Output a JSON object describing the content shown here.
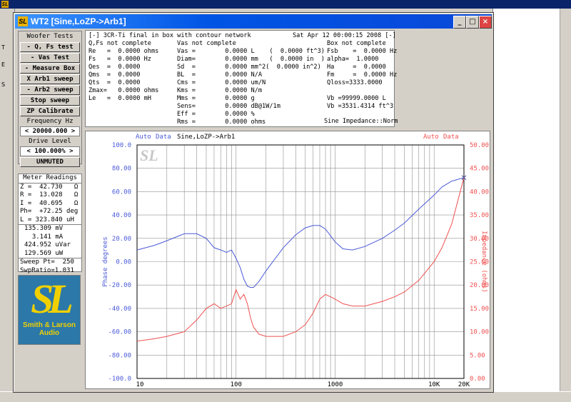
{
  "window": {
    "title": "WT2 [Sine,LoZP->Arb1]"
  },
  "left_panel": {
    "header": "Woofer Tests",
    "buttons": [
      "- Q, Fs test",
      "- Vas Test",
      "- Measure Box",
      "X Arb1 sweep",
      "- Arb2 sweep",
      "Stop sweep",
      "ZP Calibrate"
    ],
    "freq_label": "Frequency Hz",
    "freq_value": "< 20000.000 >",
    "drive_label": "Drive Level",
    "drive_value": "< 100.000% >",
    "mute": "UNMUTED"
  },
  "meter": {
    "header": "Meter Readings",
    "rows": [
      "Z =  42.730   Ω",
      "R =  13.028   Ω",
      "I =  40.695   Ω",
      "Ph=  +72.25 deg",
      "L = 323.840 uH"
    ],
    "rows2": [
      "135.309 mV",
      "  3.141 mA",
      "424.952 uVar",
      "129.569 uW"
    ],
    "rows3": [
      "Sweep Pt=  250",
      "SwpRatio=1.031"
    ]
  },
  "logo": {
    "name_line1": "Smith & Larson",
    "name_line2": "Audio"
  },
  "info": {
    "header_left": "[-] 3CR-Ti final in box with contour network",
    "header_right": "Sat Apr 12 00:00:15 2008 [-]",
    "col1_title": "Q,Fs not complete",
    "col2_title": "Vas not complete",
    "col3_title": "Box not complete",
    "col1": [
      "Re   =  0.0000 ohms",
      "Fs   =  0.0000 Hz",
      "Qes  =  0.0000",
      "Qms  =  0.0000",
      "Qts  =  0.0000",
      "Zmax=   0.0000 ohms",
      "Le   =  0.0000 mH"
    ],
    "col2": [
      "Vas =        0.0000 L    (  0.0000 ft^3)",
      "Diam=        0.0000 mm   (  0.0000 in  )",
      "Sd  =        0.0000 mm^2(  0.0000 in^2)",
      "BL  =        0.0000 N/A",
      "Cms =        0.0000 um/N",
      "Kms =        0.0000 N/m",
      "Mms =        0.0000 g",
      "Sens=        0.0000 dB@1W/1m",
      "Eff =        0.0000 %",
      "Rms =        0.0000 ohms"
    ],
    "col3": [
      "Fsb    =  0.0000 Hz",
      "alpha=  1.0000",
      "Ha     =  0.0000",
      "Fm     =  0.0000 Hz",
      "Qloss=3333.0000",
      "",
      "Vb =99999.0000 L",
      "Vb =3531.4314 ft^3"
    ],
    "footer_right": "Sine Impedance::Norm"
  },
  "graph": {
    "left_tags": [
      "Auto",
      "Data"
    ],
    "right_tags": [
      "Auto",
      "Data"
    ],
    "title": "Sine,LoZP->Arb1"
  },
  "colors": {
    "phase": "#4a5ad8",
    "impedance": "#f05050",
    "grid": "#909090"
  },
  "chart_data": {
    "type": "line",
    "xscale": "log",
    "xlim": [
      10,
      20000
    ],
    "x_tick_labels": [
      "10",
      "100",
      "1000",
      "10K",
      "20K"
    ],
    "y_left": {
      "label": "Phase degrees",
      "lim": [
        -100,
        100
      ],
      "ticks": [
        "100.0",
        "80.00",
        "60.00",
        "40.00",
        "20.00",
        "0.00",
        "-20.00",
        "-40.00",
        "-60.00",
        "-80.00",
        "-100.0"
      ]
    },
    "y_right": {
      "label": "Impedance (ohms)",
      "lim": [
        0,
        50
      ],
      "ticks": [
        "50.00",
        "45.00",
        "40.00",
        "35.00",
        "30.00",
        "25.00",
        "20.00",
        "15.00",
        "10.00",
        "5.00",
        "0.00"
      ]
    },
    "series": [
      {
        "axis": "left",
        "x": [
          10,
          15,
          20,
          30,
          40,
          50,
          60,
          70,
          80,
          90,
          100,
          110,
          120,
          130,
          140,
          150,
          170,
          200,
          300,
          400,
          500,
          600,
          700,
          800,
          1000,
          1200,
          1500,
          2000,
          3000,
          4000,
          5000,
          7000,
          10000,
          12000,
          15000,
          20000
        ],
        "values": [
          10,
          14,
          18,
          24,
          24,
          20,
          12,
          10,
          8,
          10,
          3,
          -5,
          -15,
          -21,
          -22,
          -22,
          -17,
          -8,
          12,
          23,
          29,
          31,
          31,
          28,
          17,
          11,
          10,
          13,
          20,
          27,
          33,
          45,
          57,
          64,
          69,
          72
        ]
      },
      {
        "axis": "right",
        "x": [
          10,
          15,
          20,
          30,
          40,
          50,
          60,
          70,
          80,
          90,
          100,
          110,
          120,
          130,
          140,
          150,
          170,
          200,
          300,
          400,
          500,
          600,
          700,
          800,
          1000,
          1200,
          1500,
          2000,
          3000,
          4000,
          5000,
          7000,
          10000,
          12000,
          15000,
          20000
        ],
        "values": [
          8,
          8.5,
          9,
          10,
          12.5,
          15,
          16,
          15,
          15.5,
          16,
          19,
          17,
          18,
          16,
          13,
          11,
          9.5,
          9,
          9,
          10,
          11.5,
          14,
          17,
          18,
          17,
          16,
          15.5,
          15.5,
          16.5,
          17.5,
          18.5,
          21,
          25,
          28,
          33,
          43
        ]
      }
    ]
  }
}
